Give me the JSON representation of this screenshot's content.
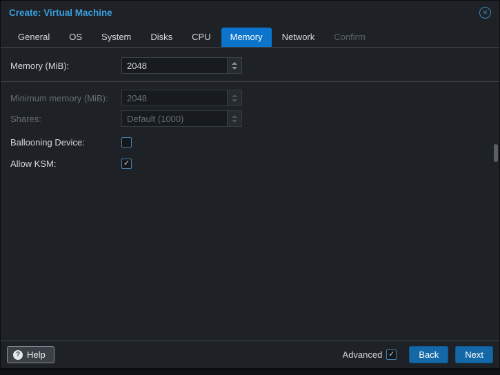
{
  "window": {
    "title": "Create: Virtual Machine"
  },
  "icons": {
    "close_glyph": "×",
    "help_glyph": "?",
    "check_glyph": "✓"
  },
  "tabs": [
    {
      "label": "General",
      "state": "normal"
    },
    {
      "label": "OS",
      "state": "normal"
    },
    {
      "label": "System",
      "state": "normal"
    },
    {
      "label": "Disks",
      "state": "normal"
    },
    {
      "label": "CPU",
      "state": "normal"
    },
    {
      "label": "Memory",
      "state": "active"
    },
    {
      "label": "Network",
      "state": "normal"
    },
    {
      "label": "Confirm",
      "state": "disabled"
    }
  ],
  "form": {
    "memory": {
      "label": "Memory (MiB):",
      "value": "2048",
      "enabled": true
    },
    "min_memory": {
      "label": "Minimum memory (MiB):",
      "value": "2048",
      "enabled": false
    },
    "shares": {
      "label": "Shares:",
      "value": "Default (1000)",
      "enabled": false
    },
    "ballooning": {
      "label": "Ballooning Device:",
      "checked": false
    },
    "ksm": {
      "label": "Allow KSM:",
      "checked": true
    }
  },
  "footer": {
    "help_label": "Help",
    "advanced_label": "Advanced",
    "advanced_checked": true,
    "back_label": "Back",
    "next_label": "Next"
  },
  "colors": {
    "title_blue": "#3a9ddb",
    "tab_active": "#0c74cc",
    "btn_bg": "#1468a8",
    "chk_border": "#4780ab",
    "dialog_bg": "#1e2226",
    "field_bg": "#171b1f",
    "divider": "#41484f"
  }
}
